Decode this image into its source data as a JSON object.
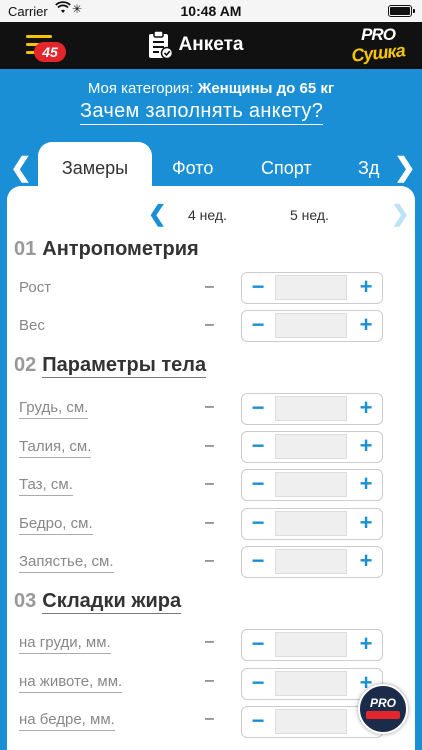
{
  "status_bar": {
    "carrier": "Carrier",
    "time": "10:48 AM"
  },
  "navbar": {
    "badge": "45",
    "title": "Анкета",
    "logo_top": "PRO",
    "logo_bottom": "Сушка",
    "accent_color": "#f6c400",
    "badge_color": "#e4252b"
  },
  "header": {
    "category_prefix": "Моя категория: ",
    "category_value": "Женщины до 65 кг",
    "why_link": "Зачем заполнять анкету?",
    "background_color": "#1a8fd6"
  },
  "tabs": [
    {
      "label": "Замеры",
      "active": true
    },
    {
      "label": "Фото",
      "active": false
    },
    {
      "label": "Спорт",
      "active": false
    },
    {
      "label": "Зд",
      "active": false
    }
  ],
  "weeks": {
    "previous": "4 нед.",
    "current": "5 нед."
  },
  "sections": [
    {
      "num": "01",
      "title": "Антропометрия",
      "rows": [
        {
          "label": "Рост",
          "prev": "–"
        },
        {
          "label": "Вес",
          "prev": "–"
        }
      ]
    },
    {
      "num": "02",
      "title": "Параметры тела",
      "rows": [
        {
          "label": "Грудь, см.",
          "prev": "–"
        },
        {
          "label": "Талия, см.",
          "prev": "–"
        },
        {
          "label": "Таз, см.",
          "prev": "–"
        },
        {
          "label": "Бедро, см.",
          "prev": "–"
        },
        {
          "label": "Запястье, см.",
          "prev": "–"
        }
      ]
    },
    {
      "num": "03",
      "title": "Складки жира",
      "rows": [
        {
          "label": "на груди, мм.",
          "prev": "–"
        },
        {
          "label": "на животе, мм.",
          "prev": "–"
        },
        {
          "label": "на бедре, мм.",
          "prev": "–"
        }
      ]
    }
  ],
  "stepper": {
    "minus": "−",
    "plus": "+"
  },
  "round_logo": {
    "top": "PRO"
  }
}
